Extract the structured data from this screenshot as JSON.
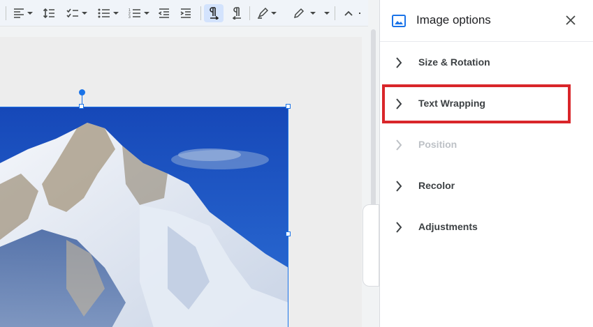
{
  "toolbar": {
    "buttons": [
      {
        "name": "align-icon"
      },
      {
        "name": "line-spacing-icon"
      },
      {
        "name": "checklist-icon"
      },
      {
        "name": "bulleted-list-icon"
      },
      {
        "name": "numbered-list-icon"
      },
      {
        "name": "decrease-indent-icon"
      },
      {
        "name": "increase-indent-icon"
      },
      {
        "name": "ltr-text-icon"
      },
      {
        "name": "rtl-text-icon"
      },
      {
        "name": "highlight-pen-icon"
      },
      {
        "name": "pen-icon"
      },
      {
        "name": "collapse-icon"
      }
    ]
  },
  "panel": {
    "title": "Image options",
    "options": [
      {
        "label": "Size & Rotation",
        "enabled": true
      },
      {
        "label": "Text Wrapping",
        "enabled": true,
        "highlighted": true
      },
      {
        "label": "Position",
        "enabled": false
      },
      {
        "label": "Recolor",
        "enabled": true
      },
      {
        "label": "Adjustments",
        "enabled": true
      }
    ]
  },
  "colors": {
    "accent": "#1a73e8",
    "highlight_box": "#d9262a",
    "sky": "#1f5fc7"
  }
}
